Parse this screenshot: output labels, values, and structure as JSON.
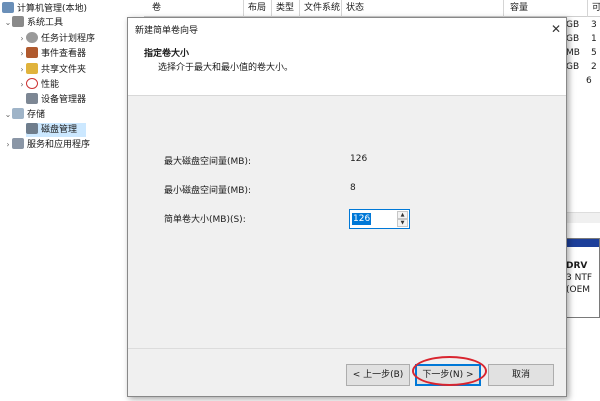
{
  "tree": {
    "root": "计算机管理(本地)",
    "system_tools": "系统工具",
    "task_scheduler": "任务计划程序",
    "event_viewer": "事件查看器",
    "shared_folders": "共享文件夹",
    "performance": "性能",
    "device_manager": "设备管理器",
    "storage": "存储",
    "disk_management": "磁盘管理",
    "services_apps": "服务和应用程序"
  },
  "columns": {
    "volume": "卷",
    "layout": "布局",
    "type": "类型",
    "filesystem": "文件系统",
    "status": "状态",
    "capacity": "容量",
    "last": "可"
  },
  "right_cells": [
    "GB",
    "GB",
    "MB",
    "GB",
    "6"
  ],
  "right_cells_b": [
    "3",
    "1",
    "5",
    "2"
  ],
  "disk_box": {
    "line1": "DRV",
    "line2": "3 NTF",
    "line3": "(OEM"
  },
  "dialog": {
    "title": "新建简单卷向导",
    "close": "✕",
    "heading": "指定卷大小",
    "subheading": "选择介于最大和最小值的卷大小。",
    "max_label": "最大磁盘空间量(MB):",
    "max_value": "126",
    "min_label": "最小磁盘空间量(MB):",
    "min_value": "8",
    "size_label": "简单卷大小(MB)(S):",
    "size_value": "126",
    "back": "< 上一步(B)",
    "next": "下一步(N) >",
    "cancel": "取消"
  },
  "colors": {
    "accent": "#0078d7",
    "highlight_ring": "#d9252f"
  }
}
